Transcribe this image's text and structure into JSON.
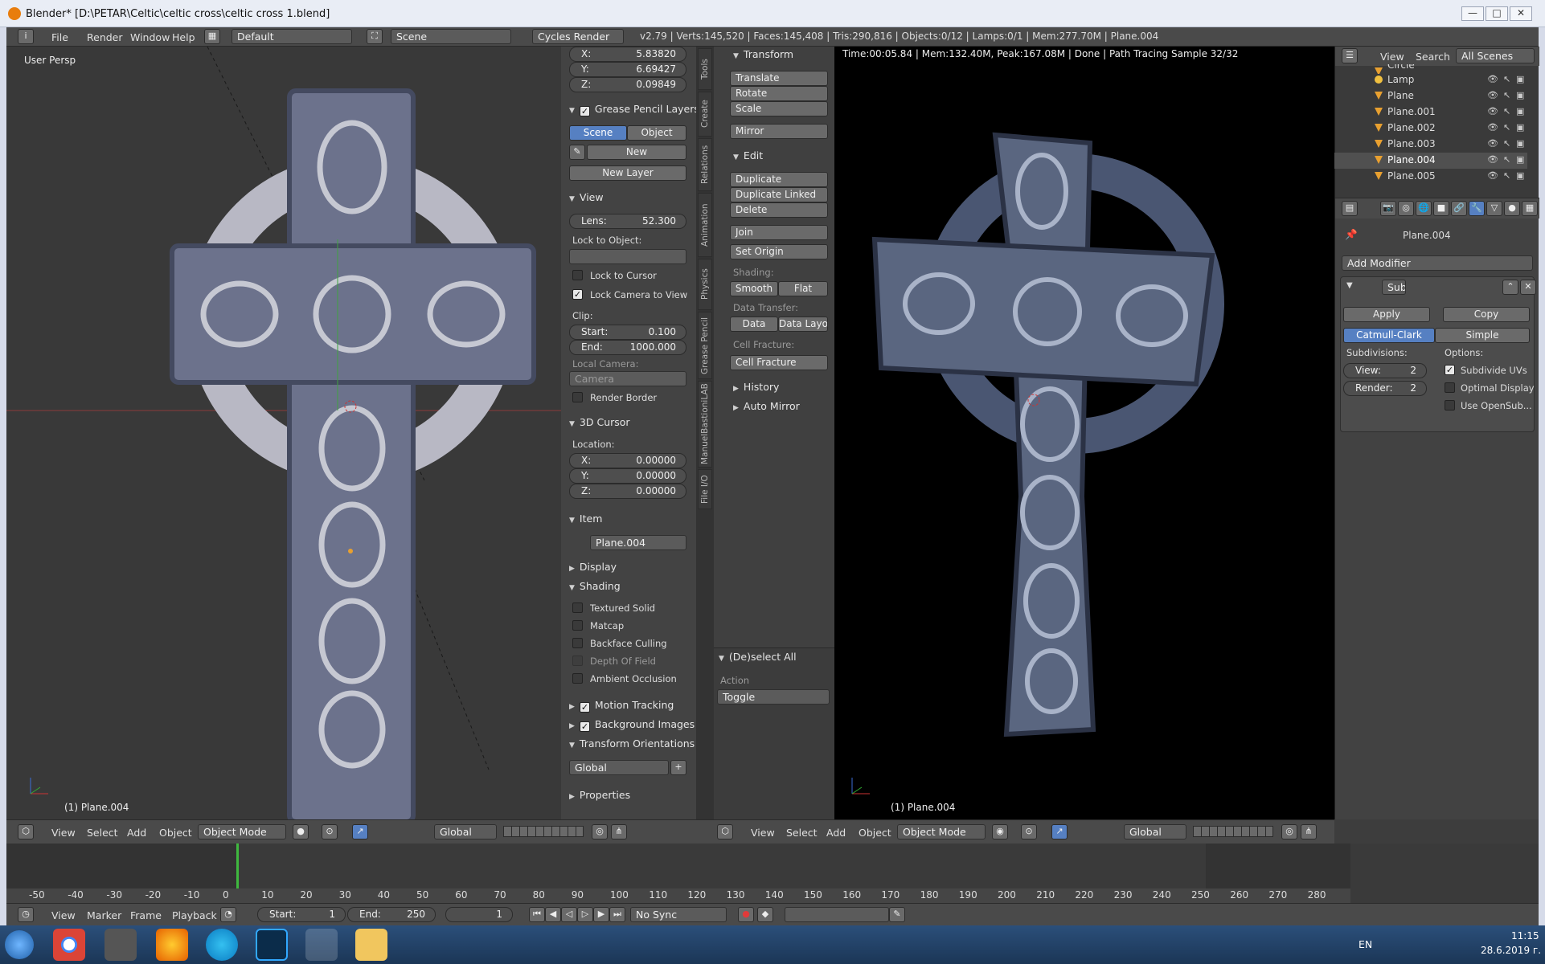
{
  "window": {
    "title": "Blender* [D:\\PETAR\\Celtic\\celtic cross\\celtic cross 1.blend]"
  },
  "menubar": {
    "file": "File",
    "render": "Render",
    "window": "Window",
    "help": "Help",
    "layout": "Default",
    "scene": "Scene",
    "engine": "Cycles Render",
    "stats": "v2.79 | Verts:145,520 | Faces:145,408 | Tris:290,816 | Objects:0/12 | Lamps:0/1 | Mem:277.70M | Plane.004"
  },
  "viewport_left": {
    "label": "User Persp",
    "object_label": "(1) Plane.004"
  },
  "viewport_right": {
    "render_info": "Time:00:05.84 | Mem:132.40M, Peak:167.08M | Done | Path Tracing Sample 32/32",
    "object_label": "(1) Plane.004"
  },
  "properties": {
    "cursor_top": {
      "x_label": "X:",
      "x": "5.83820",
      "y_label": "Y:",
      "y": "6.69427",
      "z_label": "Z:",
      "z": "0.09849"
    },
    "grease_pencil": {
      "title": "Grease Pencil Layers",
      "scene": "Scene",
      "object": "Object",
      "new": "New",
      "new_layer": "New Layer"
    },
    "view": {
      "title": "View",
      "lens_label": "Lens:",
      "lens": "52.300",
      "lock_to_object": "Lock to Object:",
      "lock_to_cursor": "Lock to Cursor",
      "lock_camera": "Lock Camera to View",
      "clip": "Clip:",
      "start_label": "Start:",
      "start": "0.100",
      "end_label": "End:",
      "end": "1000.000",
      "local_camera": "Local Camera:",
      "camera": "Camera",
      "render_border": "Render Border"
    },
    "cursor3d": {
      "title": "3D Cursor",
      "location": "Location:",
      "x_label": "X:",
      "x": "0.00000",
      "y_label": "Y:",
      "y": "0.00000",
      "z_label": "Z:",
      "z": "0.00000"
    },
    "item": {
      "title": "Item",
      "name": "Plane.004"
    },
    "display": "Display",
    "shading": {
      "title": "Shading",
      "textured_solid": "Textured Solid",
      "matcap": "Matcap",
      "backface": "Backface Culling",
      "dof": "Depth Of Field",
      "ao": "Ambient Occlusion"
    },
    "motion_tracking": "Motion Tracking",
    "background_images": "Background Images",
    "transform_orient": {
      "title": "Transform Orientations",
      "value": "Global"
    },
    "properties_label": "Properties"
  },
  "tool_tabs": [
    "Tools",
    "Create",
    "Relations",
    "Animation",
    "Physics",
    "Grease Pencil",
    "ManuelBastioniLAB",
    "File I/O"
  ],
  "tools": {
    "transform": "Transform",
    "translate": "Translate",
    "rotate": "Rotate",
    "scale": "Scale",
    "mirror": "Mirror",
    "edit": "Edit",
    "duplicate": "Duplicate",
    "duplicate_linked": "Duplicate Linked",
    "delete": "Delete",
    "join": "Join",
    "set_origin": "Set Origin",
    "shading_label": "Shading:",
    "smooth": "Smooth",
    "flat": "Flat",
    "data_transfer_label": "Data Transfer:",
    "data": "Data",
    "data_layo": "Data Layo",
    "cell_fracture_label": "Cell Fracture:",
    "cell_fracture": "Cell Fracture",
    "history": "History",
    "auto_mirror": "Auto Mirror",
    "deselect_all": "(De)select All",
    "action_label": "Action",
    "action_value": "Toggle"
  },
  "outliner": {
    "view": "View",
    "search": "Search",
    "scenes": "All Scenes",
    "items": [
      {
        "name": "Circle"
      },
      {
        "name": "Lamp"
      },
      {
        "name": "Plane"
      },
      {
        "name": "Plane.001"
      },
      {
        "name": "Plane.002"
      },
      {
        "name": "Plane.003"
      },
      {
        "name": "Plane.004"
      },
      {
        "name": "Plane.005"
      }
    ]
  },
  "modifier_panel": {
    "object": "Plane.004",
    "add_modifier": "Add Modifier",
    "mod_name": "Sub",
    "apply": "Apply",
    "copy": "Copy",
    "catmull": "Catmull-Clark",
    "simple": "Simple",
    "subdivisions": "Subdivisions:",
    "options": "Options:",
    "view_label": "View:",
    "view_val": "2",
    "render_label": "Render:",
    "render_val": "2",
    "subdivide_uvs": "Subdivide UVs",
    "optimal_display": "Optimal Display",
    "use_opensubdiv": "Use OpenSub..."
  },
  "viewport_header": {
    "view": "View",
    "select": "Select",
    "add": "Add",
    "object": "Object",
    "mode": "Object Mode",
    "orientation": "Global"
  },
  "timeline": {
    "ticks": [
      "-50",
      "-40",
      "-30",
      "-20",
      "-10",
      "0",
      "10",
      "20",
      "30",
      "40",
      "50",
      "60",
      "70",
      "80",
      "90",
      "100",
      "110",
      "120",
      "130",
      "140",
      "150",
      "160",
      "170",
      "180",
      "190",
      "200",
      "210",
      "220",
      "230",
      "240",
      "250",
      "260",
      "270",
      "280"
    ],
    "view": "View",
    "marker": "Marker",
    "frame": "Frame",
    "playback": "Playback",
    "start_label": "Start:",
    "start": "1",
    "end_label": "End:",
    "end": "250",
    "current": "1",
    "sync": "No Sync"
  },
  "taskbar": {
    "lang": "EN",
    "time": "11:15",
    "date": "28.6.2019 г."
  },
  "colors": {
    "accent": "#5680c2",
    "render_bg": "#000000",
    "viewport_bg": "#393939",
    "panel_bg": "#434343"
  }
}
